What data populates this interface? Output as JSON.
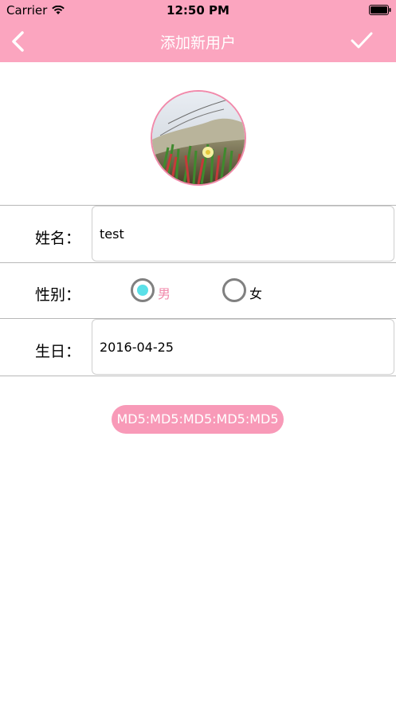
{
  "status_bar": {
    "carrier": "Carrier",
    "time": "12:50 PM"
  },
  "nav": {
    "title": "添加新用户",
    "back_icon": "chevron-left-icon",
    "confirm_icon": "checkmark-icon"
  },
  "form": {
    "name_label": "姓名：",
    "name_value": "test",
    "gender_label": "性别：",
    "gender_options": [
      "男",
      "女"
    ],
    "gender_selected": "男",
    "birthday_label": "生日：",
    "birthday_value": "2016-04-25"
  },
  "md5_button_label": "MD5:MD5:MD5:MD5:MD5",
  "colors": {
    "accent": "#fba5bf",
    "selected_radio": "#5ae0e8",
    "selected_label": "#f18aab"
  }
}
